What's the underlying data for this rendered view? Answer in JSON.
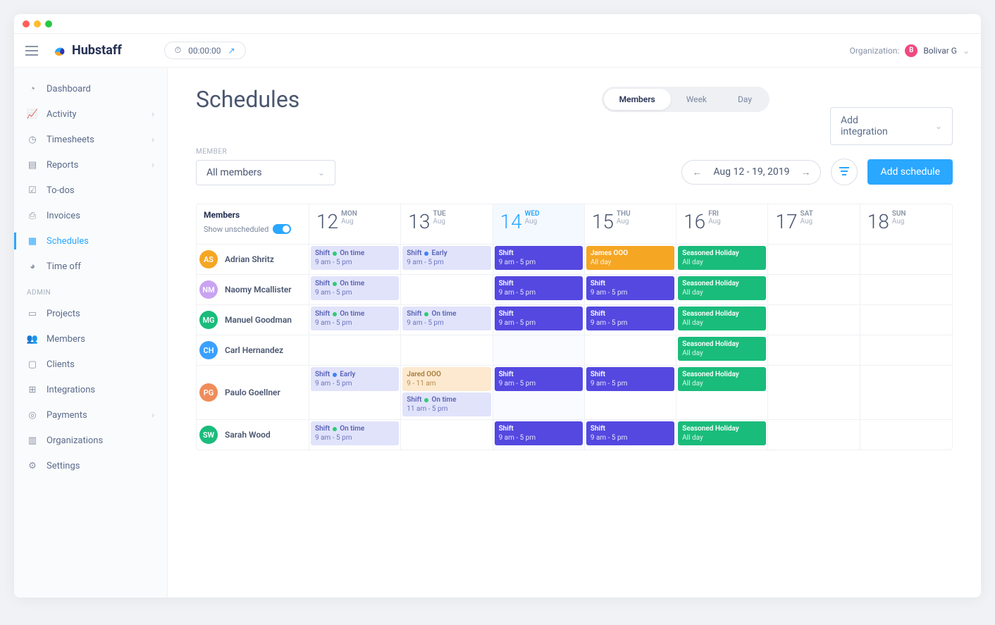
{
  "brand": "Hubstaff",
  "timer": "00:00:00",
  "org_label": "Organization:",
  "org_badge": "B",
  "org_name": "Bolivar G",
  "sidebar": {
    "items": [
      {
        "label": "Dashboard",
        "icon": "gauge-icon"
      },
      {
        "label": "Activity",
        "icon": "chart-icon",
        "chevron": true
      },
      {
        "label": "Timesheets",
        "icon": "clock-icon",
        "chevron": true
      },
      {
        "label": "Reports",
        "icon": "file-icon",
        "chevron": true
      },
      {
        "label": "To-dos",
        "icon": "check-icon"
      },
      {
        "label": "Invoices",
        "icon": "invoice-icon"
      },
      {
        "label": "Schedules",
        "icon": "calendar-icon",
        "active": true
      },
      {
        "label": "Time off",
        "icon": "pie-icon"
      }
    ],
    "admin_label": "ADMIN",
    "admin": [
      {
        "label": "Projects",
        "icon": "folder-icon"
      },
      {
        "label": "Members",
        "icon": "people-icon"
      },
      {
        "label": "Clients",
        "icon": "briefcase-icon"
      },
      {
        "label": "Integrations",
        "icon": "grid-icon"
      },
      {
        "label": "Payments",
        "icon": "wallet-icon",
        "chevron": true
      },
      {
        "label": "Organizations",
        "icon": "building-icon"
      },
      {
        "label": "Settings",
        "icon": "sliders-icon"
      }
    ]
  },
  "page_title": "Schedules",
  "tabs": [
    "Members",
    "Week",
    "Day"
  ],
  "add_integration": "Add integration",
  "member_filter_label": "MEMBER",
  "member_filter_value": "All members",
  "date_range": "Aug 12 - 19, 2019",
  "add_schedule": "Add schedule",
  "grid": {
    "members_header": "Members",
    "toggle_label": "Show unscheduled",
    "days": [
      {
        "num": "12",
        "dow": "MON",
        "mon": "Aug"
      },
      {
        "num": "13",
        "dow": "TUE",
        "mon": "Aug"
      },
      {
        "num": "14",
        "dow": "WED",
        "mon": "Aug",
        "today": true
      },
      {
        "num": "15",
        "dow": "THU",
        "mon": "Aug"
      },
      {
        "num": "16",
        "dow": "FRI",
        "mon": "Aug"
      },
      {
        "num": "17",
        "dow": "SAT",
        "mon": "Aug"
      },
      {
        "num": "18",
        "dow": "SUN",
        "mon": "Aug"
      }
    ],
    "members": [
      {
        "name": "Adrian Shritz",
        "color": "#f5a623",
        "cells": [
          [
            {
              "t": "Shift",
              "s": "9 am - 5 pm",
              "c": "lavender",
              "status": "ontime",
              "statusLabel": "On time"
            }
          ],
          [
            {
              "t": "Shift",
              "s": "9 am - 5 pm",
              "c": "lavender",
              "status": "early",
              "statusLabel": "Early"
            }
          ],
          [
            {
              "t": "Shift",
              "s": "9 am - 5 pm",
              "c": "indigo"
            }
          ],
          [
            {
              "t": "James OOO",
              "s": "All day",
              "c": "orange"
            }
          ],
          [
            {
              "t": "Seasoned Holiday",
              "s": "All day",
              "c": "green"
            }
          ],
          [],
          []
        ]
      },
      {
        "name": "Naomy Mcallister",
        "color": "#c9a3f1",
        "cells": [
          [
            {
              "t": "Shift",
              "s": "9 am - 5 pm",
              "c": "lavender",
              "status": "ontime",
              "statusLabel": "On time"
            }
          ],
          [],
          [
            {
              "t": "Shift",
              "s": "9 am - 5 pm",
              "c": "indigo"
            }
          ],
          [
            {
              "t": "Shift",
              "s": "9 am - 5 pm",
              "c": "indigo"
            }
          ],
          [
            {
              "t": "Seasoned Holiday",
              "s": "All day",
              "c": "green"
            }
          ],
          [],
          []
        ]
      },
      {
        "name": "Manuel Goodman",
        "color": "#1abc7b",
        "cells": [
          [
            {
              "t": "Shift",
              "s": "9 am - 5 pm",
              "c": "lavender",
              "status": "ontime",
              "statusLabel": "On time"
            }
          ],
          [
            {
              "t": "Shift",
              "s": "9 am - 5 pm",
              "c": "lavender",
              "status": "ontime",
              "statusLabel": "On time"
            }
          ],
          [
            {
              "t": "Shift",
              "s": "9 am - 5 pm",
              "c": "indigo"
            }
          ],
          [
            {
              "t": "Shift",
              "s": "9 am - 5 pm",
              "c": "indigo"
            }
          ],
          [
            {
              "t": "Seasoned Holiday",
              "s": "All day",
              "c": "green"
            }
          ],
          [],
          []
        ]
      },
      {
        "name": "Carl Hernandez",
        "color": "#3aa0ff",
        "cells": [
          [],
          [],
          [],
          [],
          [
            {
              "t": "Seasoned Holiday",
              "s": "All day",
              "c": "green"
            }
          ],
          [],
          []
        ]
      },
      {
        "name": "Paulo Goellner",
        "color": "#f08c5a",
        "cells": [
          [
            {
              "t": "Shift",
              "s": "9 am - 5 pm",
              "c": "lavender",
              "status": "early",
              "statusLabel": "Early"
            }
          ],
          [
            {
              "t": "Jared OOO",
              "s": "9 - 11 am",
              "c": "peach"
            },
            {
              "t": "Shift",
              "s": "11 am - 5 pm",
              "c": "lavender",
              "status": "ontime",
              "statusLabel": "On time"
            }
          ],
          [
            {
              "t": "Shift",
              "s": "9 am - 5 pm",
              "c": "indigo"
            }
          ],
          [
            {
              "t": "Shift",
              "s": "9 am - 5 pm",
              "c": "indigo"
            }
          ],
          [
            {
              "t": "Seasoned Holiday",
              "s": "All day",
              "c": "green"
            }
          ],
          [],
          []
        ]
      },
      {
        "name": "Sarah Wood",
        "color": "#1abc7b",
        "cells": [
          [
            {
              "t": "Shift",
              "s": "9 am - 5 pm",
              "c": "lavender",
              "status": "ontime",
              "statusLabel": "On time"
            }
          ],
          [],
          [
            {
              "t": "Shift",
              "s": "9 am - 5 pm",
              "c": "indigo"
            }
          ],
          [
            {
              "t": "Shift",
              "s": "9 am - 5 pm",
              "c": "indigo"
            }
          ],
          [
            {
              "t": "Seasoned Holiday",
              "s": "All day",
              "c": "green"
            }
          ],
          [],
          []
        ]
      }
    ]
  }
}
